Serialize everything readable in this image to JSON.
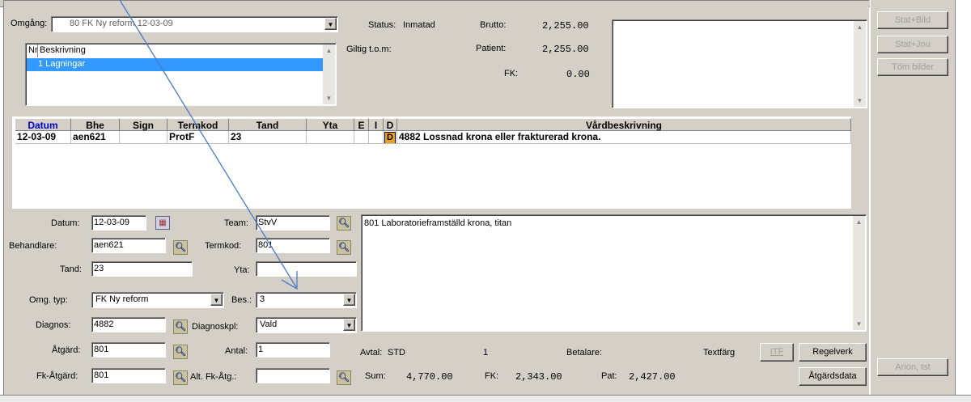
{
  "header": {
    "omgang_label": "Omgång:",
    "omgang_value": "80 FK Ny reform  12-03-09",
    "list_columns": [
      "Nr",
      "Beskrivning"
    ],
    "list_rows": [
      {
        "text": "1 Lagningar"
      }
    ],
    "status_label": "Status:",
    "status_value": "Inmatad",
    "giltig_label": "Giltig t.o.m:",
    "brutto_label": "Brutto:",
    "brutto_value": "2,255.00",
    "patient_label": "Patient:",
    "patient_value": "2,255.00",
    "fk_label": "FK:",
    "fk_value": "0.00"
  },
  "grid": {
    "columns": [
      "Datum",
      "Bhe",
      "Sign",
      "Termkod",
      "Tand",
      "Yta",
      "E",
      "I",
      "D",
      "Vårdbeskrivning"
    ],
    "rows": [
      {
        "datum": "12-03-09",
        "bhe": "aen621",
        "sign": "",
        "termkod": "ProtF",
        "tand": "23",
        "yta": "",
        "e": "",
        "i": "",
        "d": "D",
        "beskrivning": "4882 Lossnad krona eller frakturerad krona."
      }
    ]
  },
  "form": {
    "datum_label": "Datum:",
    "datum_value": "12-03-09",
    "team_label": "Team:",
    "team_value": "StvV",
    "behandlare_label": "Behandlare:",
    "behandlare_value": "aen621",
    "termkod_label": "Termkod:",
    "termkod_value": "801",
    "tand_label": "Tand:",
    "tand_value": "23",
    "yta_label": "Yta:",
    "yta_value": "",
    "omgtyp_label": "Omg. typ:",
    "omgtyp_value": "FK Ny reform",
    "bes_label": "Bes.:",
    "bes_value": "3",
    "diagnos_label": "Diagnos:",
    "diagnos_value": "4882",
    "diagnoskpl_label": "Diagnoskpl:",
    "diagnoskpl_value": "Vald",
    "atgard_label": "Åtgärd:",
    "atgard_value": "801",
    "antal_label": "Antal:",
    "antal_value": "1",
    "fkatgard_label": "Fk-Åtgärd:",
    "fkatgard_value": "801",
    "altfkatg_label": "Alt. Fk-Åtg.:",
    "altfkatg_value": "",
    "description_text": "801 Laboratorieframställd krona, titan"
  },
  "footer": {
    "avtal_label": "Avtal:",
    "avtal_value": "STD",
    "count_value": "1",
    "betalare_label": "Betalare:",
    "textfarg_label": "Textfärg",
    "itf_label": "ITF",
    "regelverk_label": "Regelverk",
    "sum_label": "Sum:",
    "sum_value": "4,770.00",
    "fk_label": "FK:",
    "fk_value": "2,343.00",
    "pat_label": "Pat:",
    "pat_value": "2,427.00",
    "atgardsdata_label": "Åtgärdsdata"
  },
  "side_buttons": {
    "stat_bild": "Stat+Bild",
    "stat_jou": "Stat+Jou",
    "tom_bilder": "Töm bilder",
    "arion_tst": "Arion, tst"
  },
  "colors": {
    "selection": "#3399ff",
    "header_blue": "#0000cc",
    "arrow": "#4a7bc8",
    "d_badge": "#e8a020"
  }
}
